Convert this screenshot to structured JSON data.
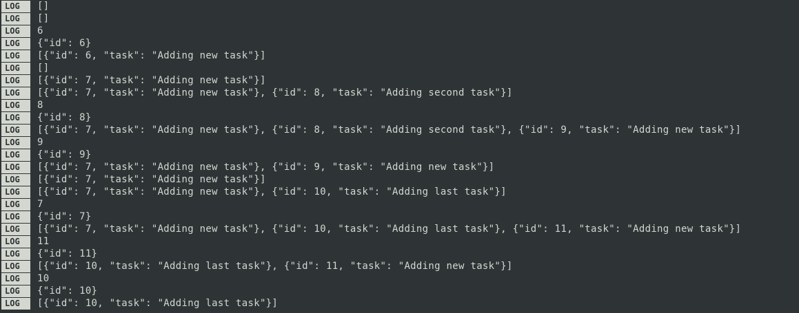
{
  "log_tag": "LOG",
  "lines": [
    "[]",
    "[]",
    "6",
    "{\"id\": 6}",
    "[{\"id\": 6, \"task\": \"Adding new task\"}]",
    "[]",
    "[{\"id\": 7, \"task\": \"Adding new task\"}]",
    "[{\"id\": 7, \"task\": \"Adding new task\"}, {\"id\": 8, \"task\": \"Adding second task\"}]",
    "8",
    "{\"id\": 8}",
    "[{\"id\": 7, \"task\": \"Adding new task\"}, {\"id\": 8, \"task\": \"Adding second task\"}, {\"id\": 9, \"task\": \"Adding new task\"}]",
    "9",
    "{\"id\": 9}",
    "[{\"id\": 7, \"task\": \"Adding new task\"}, {\"id\": 9, \"task\": \"Adding new task\"}]",
    "[{\"id\": 7, \"task\": \"Adding new task\"}]",
    "[{\"id\": 7, \"task\": \"Adding new task\"}, {\"id\": 10, \"task\": \"Adding last task\"}]",
    "7",
    "{\"id\": 7}",
    "[{\"id\": 7, \"task\": \"Adding new task\"}, {\"id\": 10, \"task\": \"Adding last task\"}, {\"id\": 11, \"task\": \"Adding new task\"}]",
    "11",
    "{\"id\": 11}",
    "[{\"id\": 10, \"task\": \"Adding last task\"}, {\"id\": 11, \"task\": \"Adding new task\"}]",
    "10",
    "{\"id\": 10}",
    "[{\"id\": 10, \"task\": \"Adding last task\"}]"
  ],
  "colors": {
    "background": "#2e3436",
    "tag_background": "#d3d7cf",
    "tag_text": "#2e3436",
    "text": "#d3d7cf"
  }
}
